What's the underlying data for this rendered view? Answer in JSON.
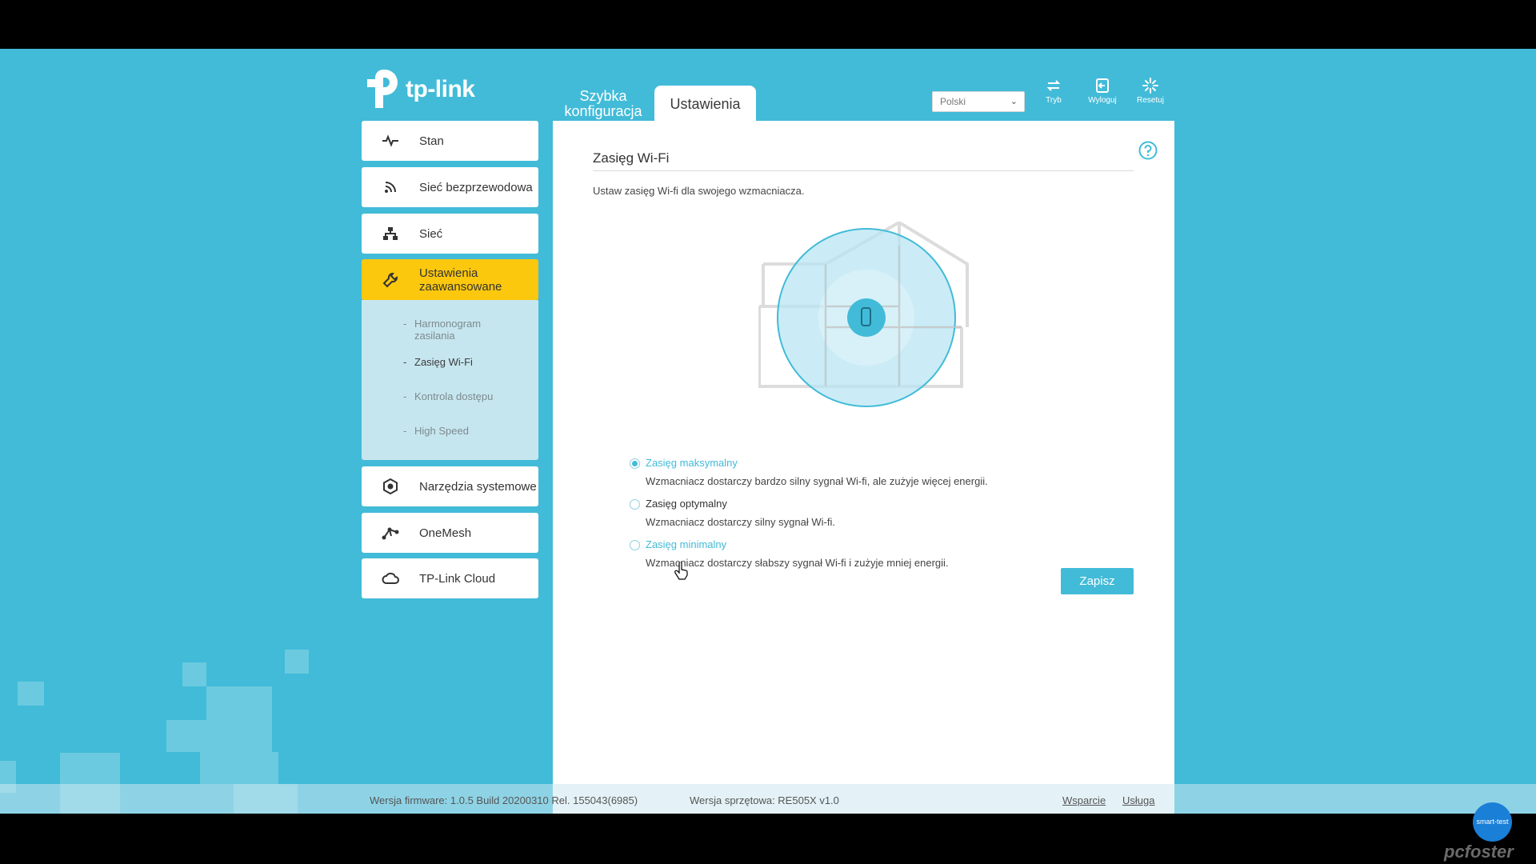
{
  "brand": {
    "logo_text": "tp-link"
  },
  "top_nav": {
    "quick_setup": "Szybka konfiguracja",
    "settings": "Ustawienia",
    "language": "Polski",
    "icons": [
      {
        "name": "mode-icon",
        "label": "Tryb"
      },
      {
        "name": "logout-icon",
        "label": "Wyloguj"
      },
      {
        "name": "reset-icon",
        "label": "Resetuj"
      }
    ]
  },
  "sidebar": {
    "items": [
      {
        "label": "Stan",
        "icon": "pulse-icon"
      },
      {
        "label": "Sieć bezprzewodowa",
        "icon": "wireless-icon"
      },
      {
        "label": "Sieć",
        "icon": "network-icon"
      },
      {
        "label": "Ustawienia zaawansowane",
        "icon": "wrench-icon",
        "active": true
      },
      {
        "label": "Narzędzia systemowe",
        "icon": "gear-icon"
      },
      {
        "label": "OneMesh",
        "icon": "mesh-icon"
      },
      {
        "label": "TP-Link Cloud",
        "icon": "cloud-icon"
      }
    ],
    "submenu": [
      {
        "label": "Harmonogram zasilania"
      },
      {
        "label": "Zasięg Wi-Fi",
        "current": true
      },
      {
        "label": "Kontrola dostępu"
      },
      {
        "label": "High Speed"
      }
    ]
  },
  "main": {
    "title": "Zasięg Wi-Fi",
    "description": "Ustaw zasięg Wi-fi dla swojego wzmacniacza.",
    "options": [
      {
        "label": "Zasięg maksymalny",
        "description": "Wzmacniacz dostarczy bardzo silny sygnał Wi-fi, ale zużyje więcej energii.",
        "selected": true
      },
      {
        "label": "Zasięg optymalny",
        "description": "Wzmacniacz dostarczy silny sygnał Wi-fi.",
        "selected": false
      },
      {
        "label": "Zasięg minimalny",
        "description": "Wzmacniacz dostarczy słabszy sygnał Wi-fi i zużyje mniej energii.",
        "selected": false
      }
    ],
    "save_label": "Zapisz"
  },
  "footer": {
    "firmware": "Wersja firmware: 1.0.5 Build 20200310 Rel. 155043(6985)",
    "hardware": "Wersja sprzętowa: RE505X v1.0",
    "support": "Wsparcie",
    "service": "Usługa"
  },
  "watermark": {
    "badge": "smart-test",
    "text": "pcfoster"
  },
  "colors": {
    "accent": "#42bbd8",
    "active": "#fbc80e",
    "submenu_bg": "#c6e6ef"
  }
}
